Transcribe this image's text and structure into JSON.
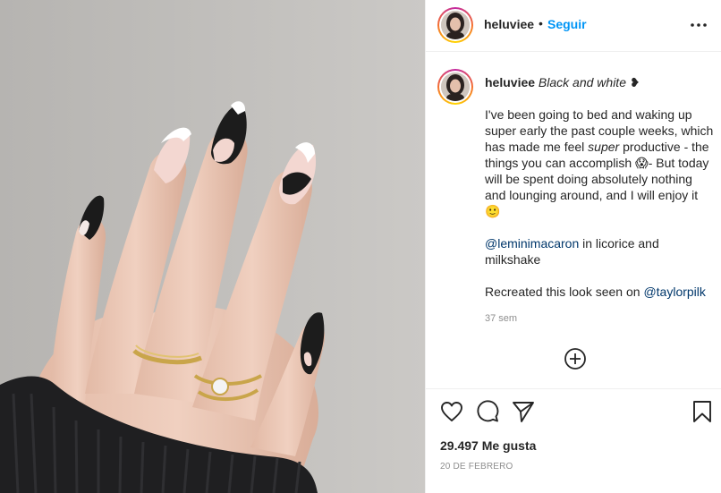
{
  "post": {
    "username": "heluviee",
    "follow_label": "Seguir",
    "separator": "•"
  },
  "caption": {
    "username": "heluviee",
    "title": "Black and white",
    "title_emoji": "❥",
    "para1_a": "I've been going to bed and waking up super early the past couple weeks, which has made me feel ",
    "para1_em": "super",
    "para1_b": " productive - the things you can accomplish ",
    "para1_emoji1": "😱",
    "para1_c": "- But today will be spent doing absolutely nothing and lounging around, and I will enjoy it ",
    "para1_emoji2": "🙂",
    "para2_mention": "@leminimacaron",
    "para2_rest": " in licorice and milkshake",
    "para3_text": "Recreated this look seen on ",
    "para3_mention": "@taylorpilk",
    "time_ago": "37 sem"
  },
  "stats": {
    "likes": "29.497 Me gusta",
    "date": "20 DE FEBRERO"
  },
  "icons": {
    "more": "more-options-icon",
    "add": "add-comment-icon",
    "like": "heart-icon",
    "comment": "comment-icon",
    "share": "share-icon",
    "save": "bookmark-icon"
  },
  "colors": {
    "link_blue": "#0095f6",
    "mention": "#00376b",
    "muted": "#8e8e8e",
    "text": "#262626"
  }
}
